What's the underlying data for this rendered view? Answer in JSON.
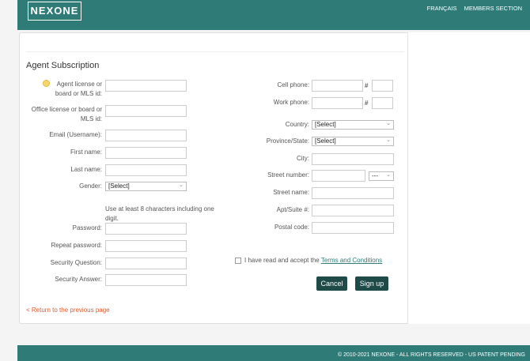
{
  "header": {
    "logo": "NEXONE",
    "links": [
      "FRANÇAIS",
      "MEMBERS SECTION"
    ]
  },
  "form": {
    "title": "Agent Subscription",
    "left_fields": {
      "agent_license_l1": "Agent license or",
      "agent_license_l2": "board or MLS id:",
      "office_license_l1": "Office license or board or",
      "office_license_l2": "MLS id:",
      "email": "Email (Username):",
      "first_name": "First name:",
      "last_name": "Last name:",
      "gender": "Gender:",
      "gender_value": "[Select]",
      "password_hint": "Use at least 8 characters including one digit.",
      "password": "Password:",
      "repeat_password": "Repeat password:",
      "security_question": "Security Question:",
      "security_answer": "Security Answer:"
    },
    "right_fields": {
      "cell_phone": "Cell phone:",
      "work_phone": "Work phone:",
      "hash": "#",
      "country": "Country:",
      "country_value": "[Select]",
      "province": "Province/State:",
      "province_value": "[Select]",
      "city": "City:",
      "street_number": "Street number:",
      "street_suffix_value": "---",
      "street_name": "Street name:",
      "apt": "Apt/Suite #:",
      "postal_code": "Postal code:"
    },
    "terms_prefix": "I have read and accept the ",
    "terms_link": "Terms and Conditions",
    "cancel_label": "Cancel",
    "signup_label": "Sign up",
    "return_link": "< Return to the previous page"
  },
  "footer": {
    "copyright": "© 2010-2021 NEXONE - ALL RIGHTS RESERVED - US PATENT PENDING"
  }
}
